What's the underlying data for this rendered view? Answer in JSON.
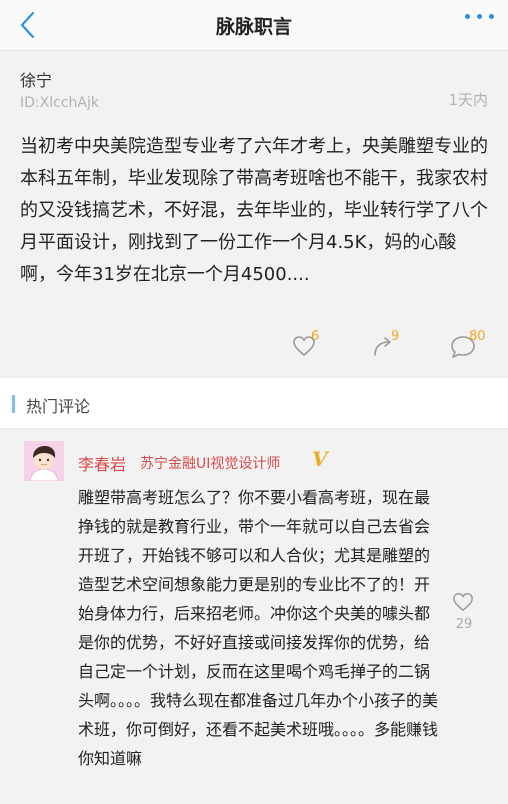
{
  "nav": {
    "title": "脉脉职言"
  },
  "post": {
    "author": "徐宁",
    "id": "ID:XlcchAjk",
    "time": "1天内",
    "content": "当初考中央美院造型专业考了六年才考上，央美雕塑专业的本科五年制，毕业发现除了带高考班啥也不能干，我家农村的又没钱搞艺术，不好混，去年毕业的，毕业转行学了八个月平面设计，刚找到了一份工作一个月4.5K，妈的心酸啊，今年31岁在北京一个月4500....",
    "likes": "6",
    "shares": "9",
    "comments": "80"
  },
  "section": {
    "label": "热门评论"
  },
  "comment": {
    "name": "李春岩",
    "title": "苏宁金融UI视觉设计师",
    "badge": "V",
    "text": "雕塑带高考班怎么了？你不要小看高考班，现在最挣钱的就是教育行业，带个一年就可以自己去省会开班了，开始钱不够可以和人合伙；尤其是雕塑的造型艺术空间想象能力更是别的专业比不了的！开始身体力行，后来招老师。冲你这个央美的噱头都是你的优势，不好好直接或间接发挥你的优势，给自己定一个计划，反而在这里喝个鸡毛掸子的二锅头啊。。。。我特么现在都准备过几年办个小孩子的美术班，你可倒好，还看不起美术班哦。。。。多能赚钱你知道嘛",
    "likes": "29"
  },
  "colors": {
    "accent": "#2f8fe0",
    "count": "#f5a623",
    "name": "#d94a4a",
    "vip": "#e8b028"
  },
  "icons": [
    "back-chevron-icon",
    "more-dots-icon",
    "heart-icon",
    "share-icon",
    "comment-bubble-icon"
  ]
}
